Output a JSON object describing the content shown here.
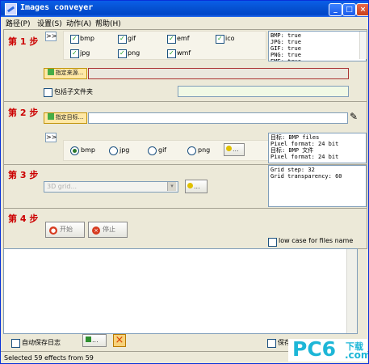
{
  "window": {
    "title": "Images conveyer"
  },
  "menu": [
    "路径(P)",
    "设置(S)",
    "动作(A)",
    "帮助(H)"
  ],
  "steps": [
    "第 1 步",
    "第 2 步",
    "第 3 步",
    "第 4 步"
  ],
  "step1": {
    "expand_label": ">>",
    "formats": [
      {
        "label": "bmp",
        "checked": true
      },
      {
        "label": "gif",
        "checked": true
      },
      {
        "label": "emf",
        "checked": true
      },
      {
        "label": "ico",
        "checked": true
      },
      {
        "label": "jpg",
        "checked": true
      },
      {
        "label": "png",
        "checked": true
      },
      {
        "label": "wmf",
        "checked": true
      }
    ],
    "info": "BMP: true\nJPG: true\nGIF: true\nPNG: true\nEMF: true",
    "source_button": "指定来源...",
    "include_subfolders": "包括子文件夹"
  },
  "step2": {
    "target_button": "指定目标...",
    "expand_label": ">>",
    "output_formats": [
      {
        "label": "bmp",
        "selected": true
      },
      {
        "label": "jpg",
        "selected": false
      },
      {
        "label": "gif",
        "selected": false
      },
      {
        "label": "png",
        "selected": false
      }
    ],
    "settings_button": "...",
    "info": "目标: BMP files\nPixel format: 24 bit\n目标: BMP 文件\nPixel format: 24 bit"
  },
  "step3": {
    "grid_select": "3D grid...",
    "settings_button": "...",
    "info": "Grid step: 32\nGrid transparency: 60"
  },
  "step4": {
    "start_button": "开始",
    "stop_button": "停止",
    "low_case_label": "low case for files name"
  },
  "bottom": {
    "autosave_log": "自动保存日志",
    "save_button": "...",
    "save_env": "保存环境选项"
  },
  "status": {
    "text": "Selected 59 effects from 59"
  },
  "watermark": {
    "brand": "PC6",
    "suffix": ".com",
    "tag": "下载"
  }
}
